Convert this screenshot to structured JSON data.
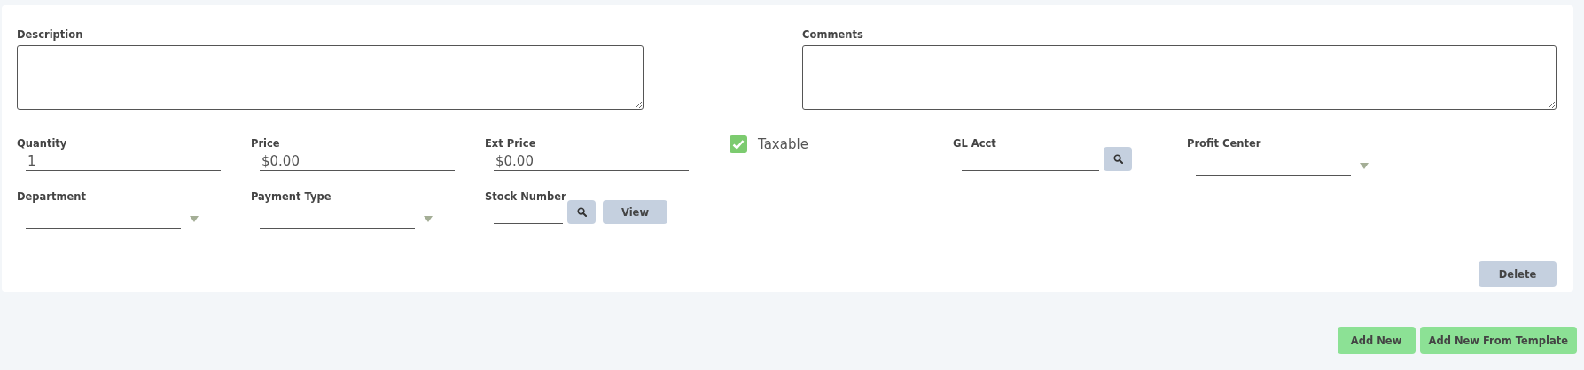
{
  "notes": [
    {
      "label": "Description"
    },
    {
      "label": "Comments"
    }
  ],
  "rows": [
    [
      {
        "kind": "text",
        "label": "Quantity",
        "value": "1"
      },
      {
        "kind": "text",
        "label": "Price",
        "value": "$0.00"
      },
      {
        "kind": "text",
        "label": "Ext Price",
        "value": "$0.00"
      },
      {
        "kind": "checkbox",
        "label": "Taxable",
        "checked": true
      },
      {
        "kind": "lookup",
        "label": "GL Acct"
      },
      {
        "kind": "select",
        "label": "Profit Center"
      }
    ],
    [
      {
        "kind": "select",
        "label": "Department"
      },
      {
        "kind": "select",
        "label": "Payment Type"
      },
      {
        "kind": "lookup",
        "label": "Stock Number",
        "button": "View"
      }
    ]
  ],
  "card_button": "Delete",
  "footer_buttons": [
    "Add New",
    "Add New From Template"
  ]
}
